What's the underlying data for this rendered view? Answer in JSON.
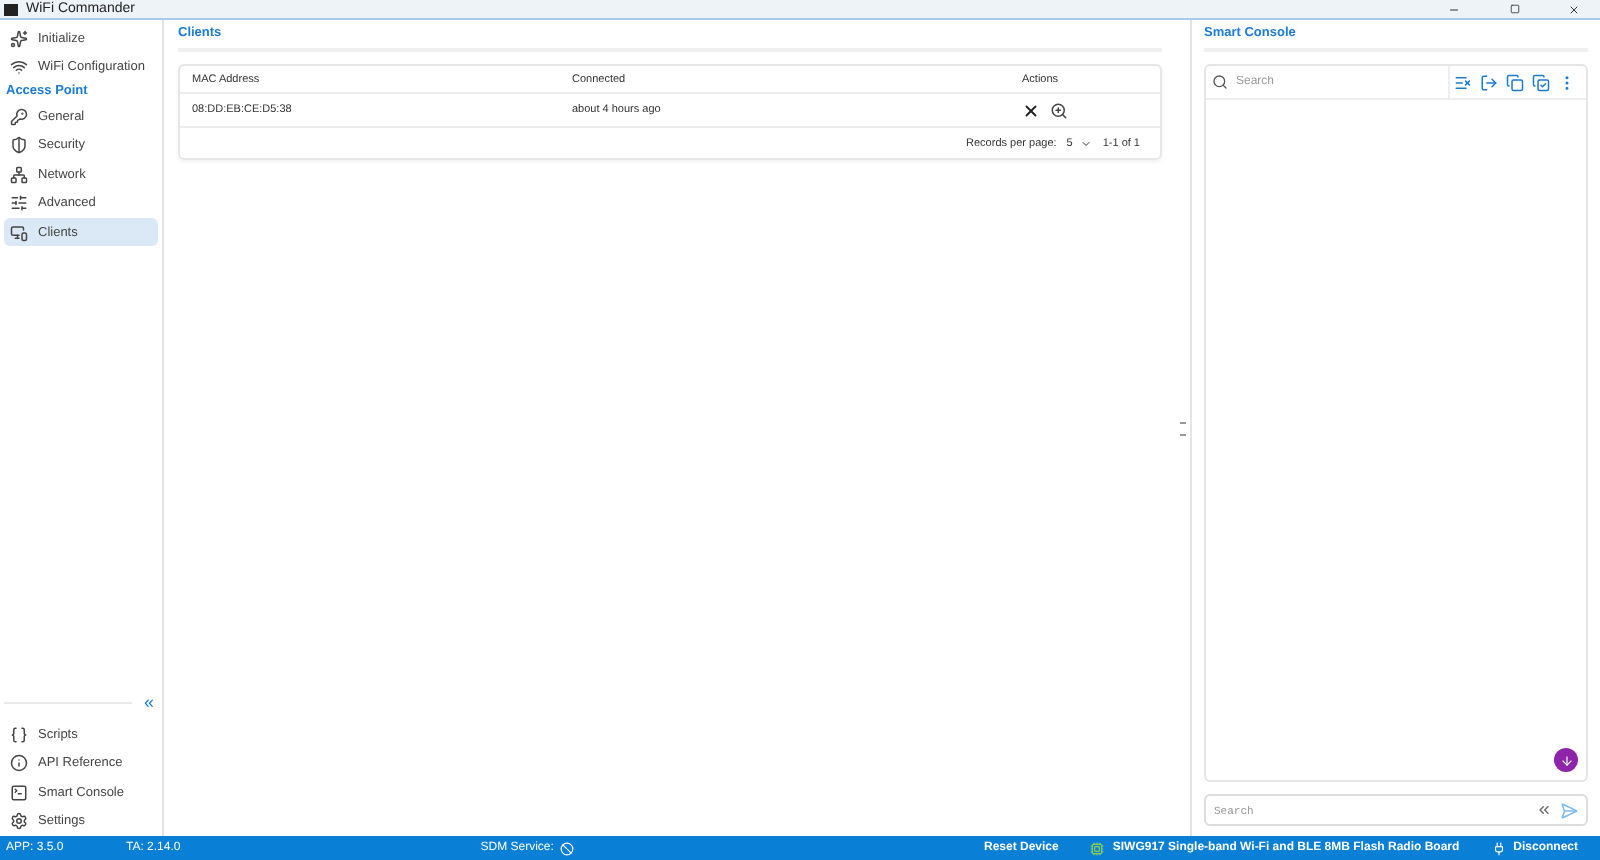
{
  "window": {
    "title": "WiFi Commander"
  },
  "sidebar": {
    "top_items": [
      {
        "label": "Initialize",
        "selected": false
      },
      {
        "label": "WiFi Configuration",
        "selected": false
      }
    ],
    "section": "Access Point",
    "section_items": [
      {
        "label": "General",
        "selected": false
      },
      {
        "label": "Security",
        "selected": false
      },
      {
        "label": "Network",
        "selected": false
      },
      {
        "label": "Advanced",
        "selected": false
      },
      {
        "label": "Clients",
        "selected": true
      }
    ],
    "collapse": "«",
    "bottom_items": [
      {
        "label": "Scripts",
        "selected": false
      },
      {
        "label": "API Reference",
        "selected": false
      },
      {
        "label": "Smart Console",
        "selected": false
      },
      {
        "label": "Settings",
        "selected": false
      }
    ]
  },
  "clients": {
    "title": "Clients",
    "columns": [
      "MAC Address",
      "Connected",
      "Actions"
    ],
    "rows": [
      {
        "mac": "08:DD:EB:CE:D5:38",
        "connected": "about 4 hours ago"
      }
    ],
    "records_label": "Records per page:",
    "per_page": "5",
    "range": "1-1 of 1"
  },
  "console": {
    "title": "Smart Console",
    "search": {
      "placeholder": "Search"
    },
    "input": {
      "placeholder": "Search"
    }
  },
  "status_bar": {
    "app": "APP: 3.5.0",
    "ta": "TA: 2.14.0",
    "sdm": "SDM Service:",
    "reset": "Reset Device",
    "board": "SIWG917 Single-band Wi-Fi and BLE 8MB Flash Radio Board",
    "disconnect": "Disconnect"
  }
}
